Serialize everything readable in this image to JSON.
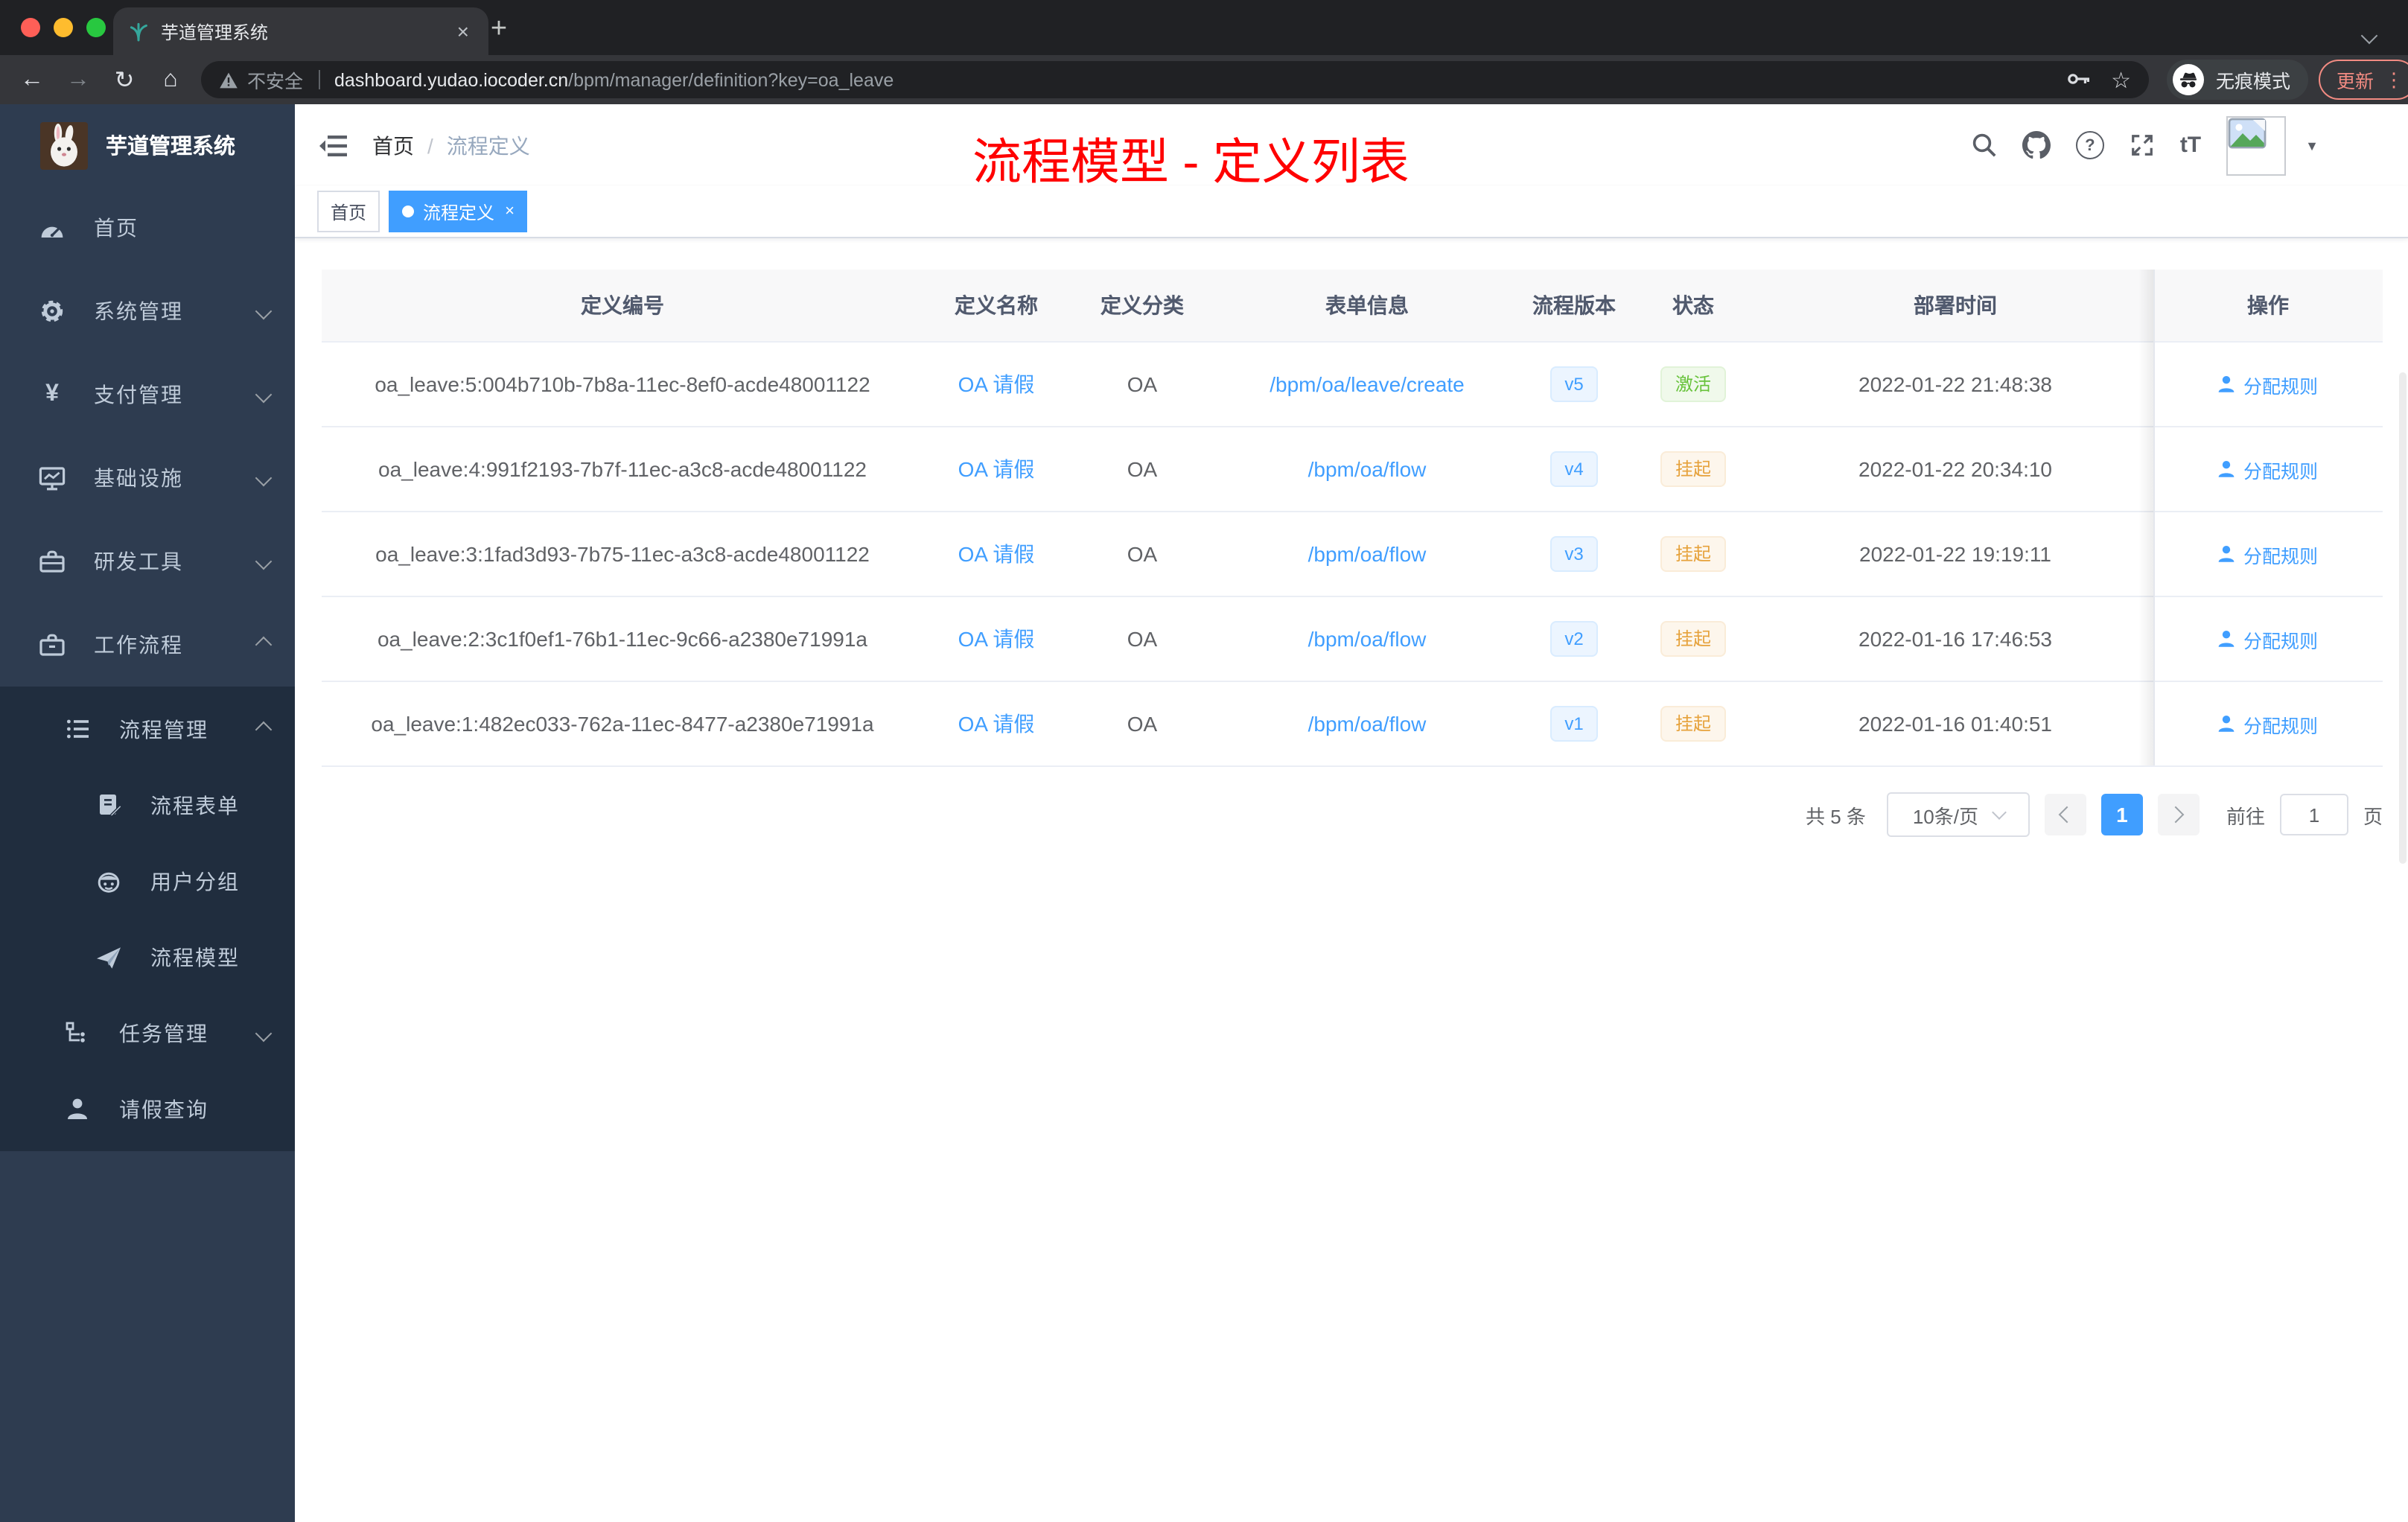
{
  "browser": {
    "tab_title": "芋道管理系统",
    "not_secure": "不安全",
    "url_host": "dashboard.yudao.iocoder.cn",
    "url_path": "/bpm/manager/definition?key=oa_leave",
    "incognito_label": "无痕模式",
    "update_label": "更新"
  },
  "icons": {
    "close": "×",
    "plus": "+",
    "kebab": "⋮",
    "star": "☆",
    "caret_down": "▼",
    "back": "←",
    "forward": "→",
    "reload": "↻",
    "home": "⌂",
    "question": "?",
    "yen": "¥",
    "font_size": "tT"
  },
  "sidebar": {
    "logo_title": "芋道管理系统",
    "menu": {
      "home": "首页",
      "system": "系统管理",
      "payment": "支付管理",
      "infra": "基础设施",
      "devtools": "研发工具",
      "workflow": "工作流程"
    },
    "submenu": {
      "process_mgmt": "流程管理",
      "process_form": "流程表单",
      "user_group": "用户分组",
      "process_model": "流程模型",
      "task_mgmt": "任务管理",
      "leave_query": "请假查询"
    }
  },
  "header": {
    "breadcrumb_home": "首页",
    "breadcrumb_sep": "/",
    "breadcrumb_current": "流程定义",
    "annotation": "流程模型 - 定义列表"
  },
  "tags": {
    "home": "首页",
    "current": "流程定义"
  },
  "table": {
    "columns": {
      "id": "定义编号",
      "name": "定义名称",
      "category": "定义分类",
      "form": "表单信息",
      "version": "流程版本",
      "status": "状态",
      "deploy_time": "部署时间",
      "ops": "操作"
    },
    "action_label": "分配规则",
    "rows": [
      {
        "id": "oa_leave:5:004b710b-7b8a-11ec-8ef0-acde48001122",
        "name": "OA 请假",
        "category": "OA",
        "form": "/bpm/oa/leave/create",
        "version": "v5",
        "status": "激活",
        "time": "2022-01-22 21:48:38"
      },
      {
        "id": "oa_leave:4:991f2193-7b7f-11ec-a3c8-acde48001122",
        "name": "OA 请假",
        "category": "OA",
        "form": "/bpm/oa/flow",
        "version": "v4",
        "status": "挂起",
        "time": "2022-01-22 20:34:10"
      },
      {
        "id": "oa_leave:3:1fad3d93-7b75-11ec-a3c8-acde48001122",
        "name": "OA 请假",
        "category": "OA",
        "form": "/bpm/oa/flow",
        "version": "v3",
        "status": "挂起",
        "time": "2022-01-22 19:19:11"
      },
      {
        "id": "oa_leave:2:3c1f0ef1-76b1-11ec-9c66-a2380e71991a",
        "name": "OA 请假",
        "category": "OA",
        "form": "/bpm/oa/flow",
        "version": "v2",
        "status": "挂起",
        "time": "2022-01-16 17:46:53"
      },
      {
        "id": "oa_leave:1:482ec033-762a-11ec-8477-a2380e71991a",
        "name": "OA 请假",
        "category": "OA",
        "form": "/bpm/oa/flow",
        "version": "v1",
        "status": "挂起",
        "time": "2022-01-16 01:40:51"
      }
    ]
  },
  "pagination": {
    "total": "共 5 条",
    "page_size": "10条/页",
    "current_page": "1",
    "goto_label": "前往",
    "goto_value": "1",
    "unit_label": "页"
  },
  "colors": {
    "accent_blue": "#409eff",
    "success_green": "#67c23a",
    "warning_orange": "#e6a23c",
    "annotation_red": "#ff0000",
    "sidebar_bg": "#2e3c50",
    "submenu_bg": "#202d3e",
    "active_tag_bg": "#409eff"
  }
}
